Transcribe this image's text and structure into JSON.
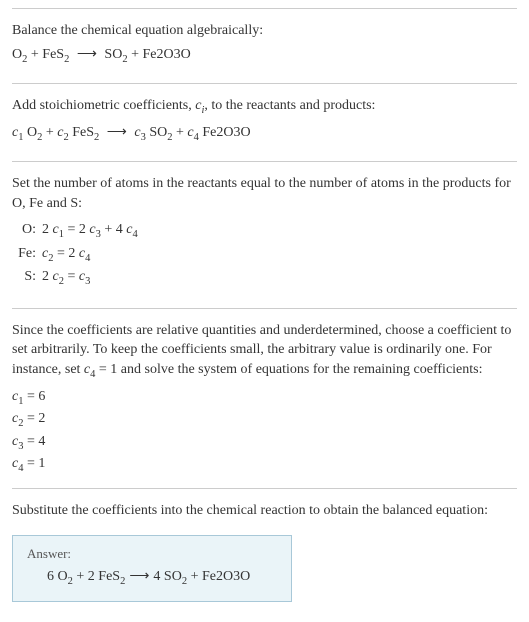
{
  "section1": {
    "title": "Balance the chemical equation algebraically:",
    "equation_parts": {
      "r1": "O",
      "r1s": "2",
      "r2": "FeS",
      "r2s": "2",
      "p1": "SO",
      "p1s": "2",
      "p2": "Fe2O3O"
    },
    "plus": " + ",
    "arrow": "⟶"
  },
  "section2": {
    "text_a": "Add stoichiometric coefficients, ",
    "ci": "c",
    "ci_sub": "i",
    "text_b": ", to the reactants and products:",
    "c1": "c",
    "c1s": "1",
    "c2": "c",
    "c2s": "2",
    "c3": "c",
    "c3s": "3",
    "c4": "c",
    "c4s": "4",
    "r1": "O",
    "r1s": "2",
    "r2": "FeS",
    "r2s": "2",
    "p1": "SO",
    "p1s": "2",
    "p2": "Fe2O3O",
    "plus": " + ",
    "arrow": "⟶"
  },
  "section3": {
    "text": "Set the number of atoms in the reactants equal to the number of atoms in the products for O, Fe and S:",
    "rows": [
      {
        "label": "O:",
        "lhs_a": "2 ",
        "c_a": "c",
        "cs_a": "1",
        "eq": " = ",
        "rhs_a": "2 ",
        "c_b": "c",
        "cs_b": "3",
        "plus": " + ",
        "rhs_b": "4 ",
        "c_c": "c",
        "cs_c": "4"
      },
      {
        "label": "Fe:",
        "c_a": "c",
        "cs_a": "2",
        "eq": " = ",
        "rhs_a": "2 ",
        "c_b": "c",
        "cs_b": "4"
      },
      {
        "label": "S:",
        "lhs_a": "2 ",
        "c_a": "c",
        "cs_a": "2",
        "eq": " = ",
        "c_b": "c",
        "cs_b": "3"
      }
    ]
  },
  "section4": {
    "text_a": "Since the coefficients are relative quantities and underdetermined, choose a coefficient to set arbitrarily. To keep the coefficients small, the arbitrary value is ordinarily one. For instance, set ",
    "c4": "c",
    "c4s": "4",
    "eq1": " = 1",
    "text_b": " and solve the system of equations for the remaining coefficients:",
    "solutions": [
      {
        "c": "c",
        "cs": "1",
        "val": " = 6"
      },
      {
        "c": "c",
        "cs": "2",
        "val": " = 2"
      },
      {
        "c": "c",
        "cs": "3",
        "val": " = 4"
      },
      {
        "c": "c",
        "cs": "4",
        "val": " = 1"
      }
    ]
  },
  "section5": {
    "text": "Substitute the coefficients into the chemical reaction to obtain the balanced equation:",
    "answer_label": "Answer:",
    "eq": {
      "n1": "6 ",
      "r1": "O",
      "r1s": "2",
      "plus1": " + ",
      "n2": "2 ",
      "r2": "FeS",
      "r2s": "2",
      "arrow": " ⟶ ",
      "n3": "4 ",
      "p1": "SO",
      "p1s": "2",
      "plus2": " + ",
      "p2": "Fe2O3O"
    }
  },
  "chart_data": {
    "type": "table",
    "title": "Balanced chemical equation coefficients",
    "reaction": "6 O2 + 2 FeS2 ⟶ 4 SO2 + Fe2O3O",
    "coefficients": {
      "c1": 6,
      "c2": 2,
      "c3": 4,
      "c4": 1
    },
    "atom_balance": [
      {
        "element": "O",
        "equation": "2 c1 = 2 c3 + 4 c4"
      },
      {
        "element": "Fe",
        "equation": "c2 = 2 c4"
      },
      {
        "element": "S",
        "equation": "2 c2 = c3"
      }
    ]
  }
}
